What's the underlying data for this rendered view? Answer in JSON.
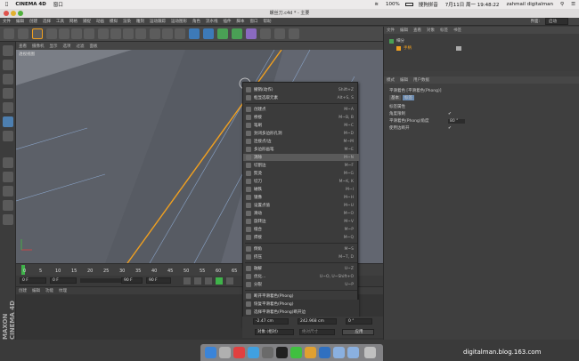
{
  "mac_bar": {
    "app_name": "CINEMA 4D",
    "menu": "窗口",
    "battery": "100%",
    "input_method": "搜狗拼音",
    "datetime": "7月11日 周一 19:48:22",
    "user": "zahmail digitalman"
  },
  "window": {
    "title": "螺丝刀.c4d * - 主要"
  },
  "menubar": [
    "文件",
    "编辑",
    "创建",
    "选择",
    "工具",
    "网格",
    "捕捉",
    "动画",
    "模拟",
    "渲染",
    "雕刻",
    "运动跟踪",
    "运动图形",
    "角色",
    "流水线",
    "插件",
    "脚本",
    "窗口",
    "帮助"
  ],
  "layout": {
    "label": "界面:",
    "value": "启动"
  },
  "viewport_menu": [
    "查看",
    "摄像机",
    "显示",
    "选项",
    "过滤",
    "面板"
  ],
  "viewport_label": "透视视图",
  "object_manager": {
    "tabs": [
      "文件",
      "编辑",
      "查看",
      "对象",
      "标签",
      "书签"
    ],
    "objects": [
      "细分",
      "手柄"
    ]
  },
  "attributes": {
    "tabs": [
      "模式",
      "编辑",
      "用户数据"
    ],
    "tag_title": "平滑着色 [平滑着色(Phong)]",
    "subtabs": [
      "基本",
      "标签"
    ],
    "section": "标签属性",
    "rows": [
      {
        "label": "角度限制",
        "value": "✔"
      },
      {
        "label": "平滑着色(Phong)角度",
        "value": "80 °"
      },
      {
        "label": "使用边断开",
        "value": "✔"
      }
    ]
  },
  "timeline": {
    "ticks": [
      "0",
      "5",
      "10",
      "15",
      "20",
      "25",
      "30",
      "35",
      "40",
      "45",
      "50",
      "55",
      "60",
      "65"
    ],
    "frame_start": "0 F",
    "frame_current": "0 F",
    "frame_end": "90 F",
    "frame_end2": "90 F"
  },
  "material": {
    "tabs": [
      "创建",
      "编辑",
      "功能",
      "纹理"
    ]
  },
  "brand": "MAXON CINEMA 4D",
  "context_menu": {
    "items": [
      {
        "label": "撤销(动作)",
        "shortcut": "Shift+Z"
      },
      {
        "label": "框显选取元素",
        "shortcut": "Alt+S, S"
      },
      {
        "label": "创建点",
        "shortcut": "M~A"
      },
      {
        "label": "桥接",
        "shortcut": "M~B, B"
      },
      {
        "label": "笔刷",
        "shortcut": "M~C"
      },
      {
        "label": "封闭多边形孔洞",
        "shortcut": "M~D"
      },
      {
        "label": "连接点/边",
        "shortcut": "M~M"
      },
      {
        "label": "多边形画笔",
        "shortcut": "M~E"
      },
      {
        "label": "消除",
        "shortcut": "M~N"
      },
      {
        "label": "切割边",
        "shortcut": "M~F"
      },
      {
        "label": "熨烫",
        "shortcut": "M~G"
      },
      {
        "label": "切刀",
        "shortcut": "M~K, K"
      },
      {
        "label": "磁铁",
        "shortcut": "M~I"
      },
      {
        "label": "镜像",
        "shortcut": "M~H"
      },
      {
        "label": "设置点值",
        "shortcut": "M~U"
      },
      {
        "label": "滑动",
        "shortcut": "M~O"
      },
      {
        "label": "旋转边",
        "shortcut": "M~V"
      },
      {
        "label": "缝合",
        "shortcut": "M~P"
      },
      {
        "label": "焊接",
        "shortcut": "M~Q"
      },
      {
        "label": "倒角",
        "shortcut": "M~S"
      },
      {
        "label": "挤压",
        "shortcut": "M~T, D"
      },
      {
        "label": "融解",
        "shortcut": "U~Z"
      },
      {
        "label": "优化...",
        "shortcut": "U~O, U~Shift+O"
      },
      {
        "label": "分裂",
        "shortcut": "U~P"
      },
      {
        "label": "断开平滑着色(Phong)",
        "shortcut": ""
      },
      {
        "label": "恢复平滑着色(Phong)",
        "shortcut": ""
      },
      {
        "label": "选择平滑着色(Phong)断开边",
        "shortcut": ""
      }
    ],
    "highlighted": "消除",
    "coord_x": "-2.47 cm",
    "coord_y": "242.968 cm",
    "coord_z": "0 °",
    "mode_select": "对象 (相对)",
    "size_select": "绝对尺寸",
    "apply_button": "应用"
  },
  "watermark": "digitalman.blog.163.com",
  "colors": {
    "accent": "#f0a020",
    "viewport": "#7a7e86",
    "ui_dark": "#3a3a3a"
  }
}
